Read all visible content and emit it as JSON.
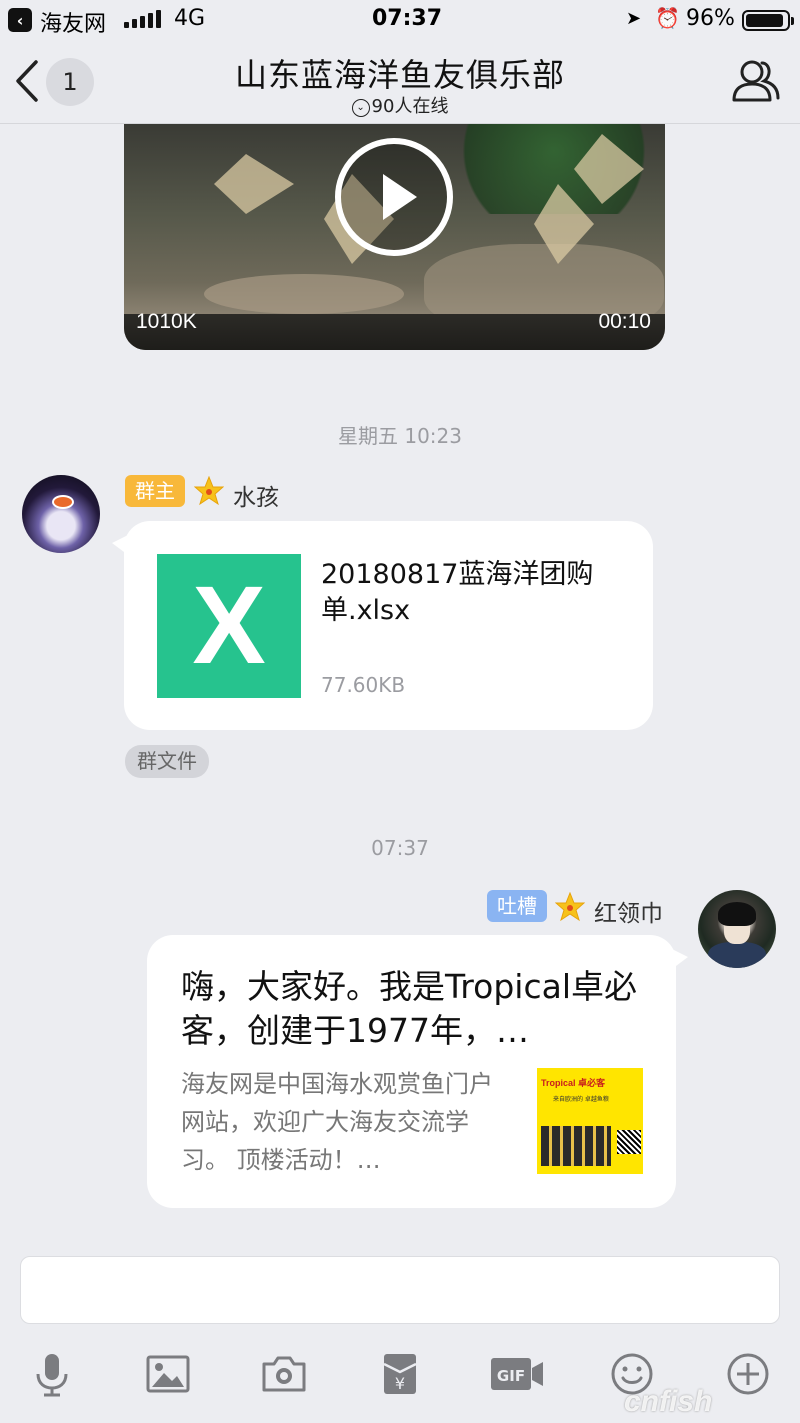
{
  "status_bar": {
    "carrier": "海友网",
    "network": "4G",
    "time": "07:37",
    "battery": "96%"
  },
  "nav": {
    "unread_count": "1",
    "title": "山东蓝海洋鱼友俱乐部",
    "online": "90人在线"
  },
  "video": {
    "size": "1010K",
    "duration": "00:10"
  },
  "messages": [
    {
      "timestamp": "星期五 10:23",
      "role": "群主",
      "sender": "水孩",
      "file": {
        "icon_letter": "X",
        "name": "20180817蓝海洋团购单.xlsx",
        "size": "77.60KB"
      },
      "tag": "群文件"
    },
    {
      "timestamp": "07:37",
      "role": "吐槽",
      "sender": "红领巾",
      "link": {
        "title": "嗨，大家好。我是Tropical卓必客，创建于1977年，…",
        "description": "海友网是中国海水观赏鱼门户网站，欢迎广大海友交流学习。 顶楼活动！…",
        "thumb_brand": "Tropical 卓必客",
        "thumb_tagline": "来自欧洲的 卓越鱼粮"
      }
    }
  ],
  "toolbar": {
    "items": [
      "microphone-icon",
      "image-icon",
      "camera-icon",
      "red-packet-icon",
      "gif-icon",
      "emoji-icon",
      "plus-icon"
    ]
  },
  "watermark": "cnfish",
  "colors": {
    "background": "#ecedf1",
    "owner_badge": "#f8b83a",
    "tucao_badge": "#8ab4f2",
    "excel_green": "#26c38e"
  }
}
